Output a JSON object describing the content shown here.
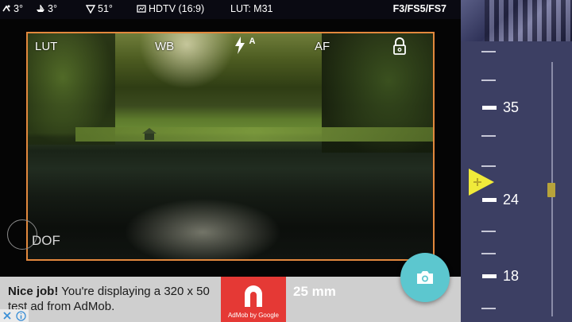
{
  "status": {
    "items": [
      {
        "icon": "weather-icon",
        "value": "3°"
      },
      {
        "icon": "boat-icon",
        "value": "3°"
      },
      {
        "icon": "angle-icon",
        "value": "51°"
      },
      {
        "icon": "aspect-ratio-icon",
        "value": "HDTV (16:9)"
      }
    ],
    "lut": "LUT: M31",
    "apertures": "F3/FS5/FS7"
  },
  "viewfinder": {
    "lut_label": "LUT",
    "wb_label": "WB",
    "af_label": "AF",
    "flash_mode": "A",
    "dof_label": "DOF",
    "frame_color": "#e2883d"
  },
  "ad": {
    "headline": "Nice job!",
    "body": "You're displaying a 320 x 50 test ad from AdMob.",
    "logo_caption": "AdMob by Google",
    "logo_color": "#e53935"
  },
  "focal_length": {
    "current": "25 mm",
    "scale_labels": [
      "35",
      "24",
      "18"
    ]
  },
  "accent": "#5cc7cf"
}
